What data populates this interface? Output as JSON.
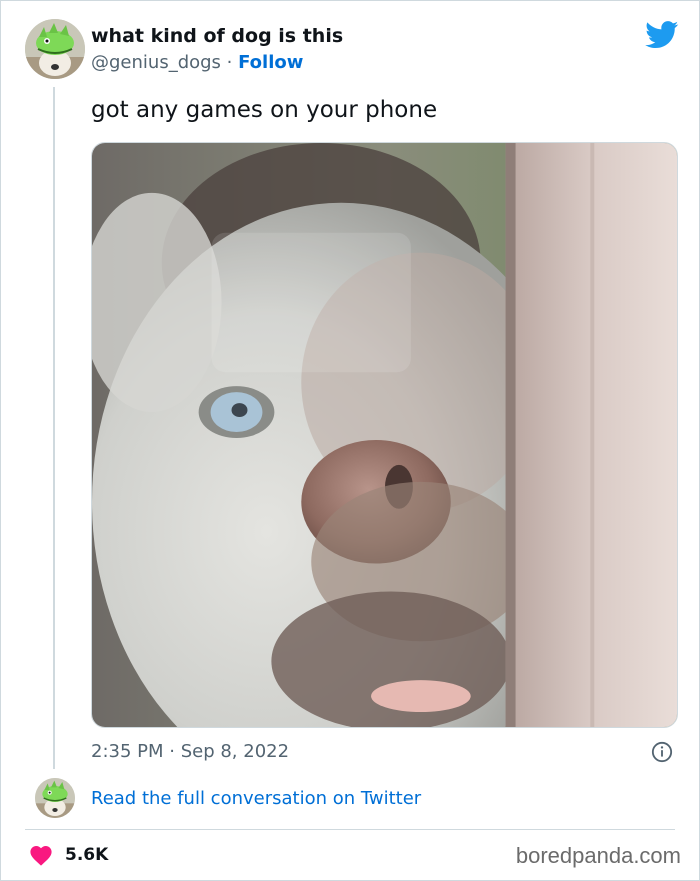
{
  "tweet": {
    "display_name": "what kind of dog is this",
    "handle": "@genius_dogs",
    "separator": " · ",
    "follow_label": "Follow",
    "text": "got any games on your phone",
    "timestamp": "2:35 PM · Sep 8, 2022",
    "read_link": "Read the full conversation on Twitter",
    "like_count": "5.6K"
  },
  "icons": {
    "brand": "twitter-bird-icon",
    "info": "info-icon",
    "like": "heart-icon"
  },
  "colors": {
    "link": "#006fd6",
    "twitter_blue": "#1d9bf0",
    "heart": "#f91880",
    "secondary_text": "#536471",
    "border": "#cfd9de"
  },
  "watermark": "boredpanda.com"
}
